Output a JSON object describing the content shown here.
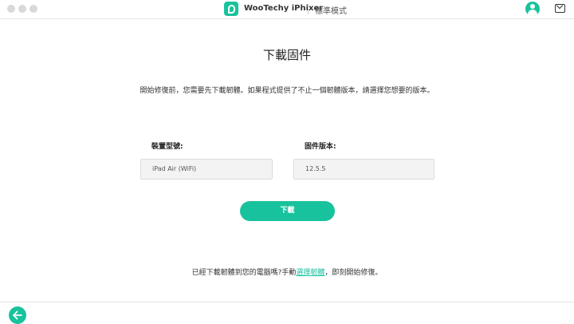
{
  "titlebar": {
    "app_title": "WooTechy iPhixer",
    "mode": "標準模式",
    "logo_icon": "iphixer-logo-icon",
    "user_icon": "user-icon",
    "mail_icon": "mail-icon"
  },
  "main": {
    "title": "下載固件",
    "subtitle": "開始修復前，您需要先下載韌體。如果程式提供了不止一個韌體版本，請選擇您想要的版本。",
    "device_model": {
      "label": "裝置型號:",
      "value": "iPad Air (WiFi)"
    },
    "firmware_version": {
      "label": "固件版本:",
      "value": "12.5.5"
    },
    "download_button": "下載",
    "footer": {
      "prefix": "已經下載韌體到您的電腦嗎?手動",
      "link": "選擇韌體",
      "suffix": "，即刻開始修復。"
    }
  },
  "bottom": {
    "back_icon": "back-arrow-icon"
  },
  "colors": {
    "accent": "#18c29c"
  }
}
